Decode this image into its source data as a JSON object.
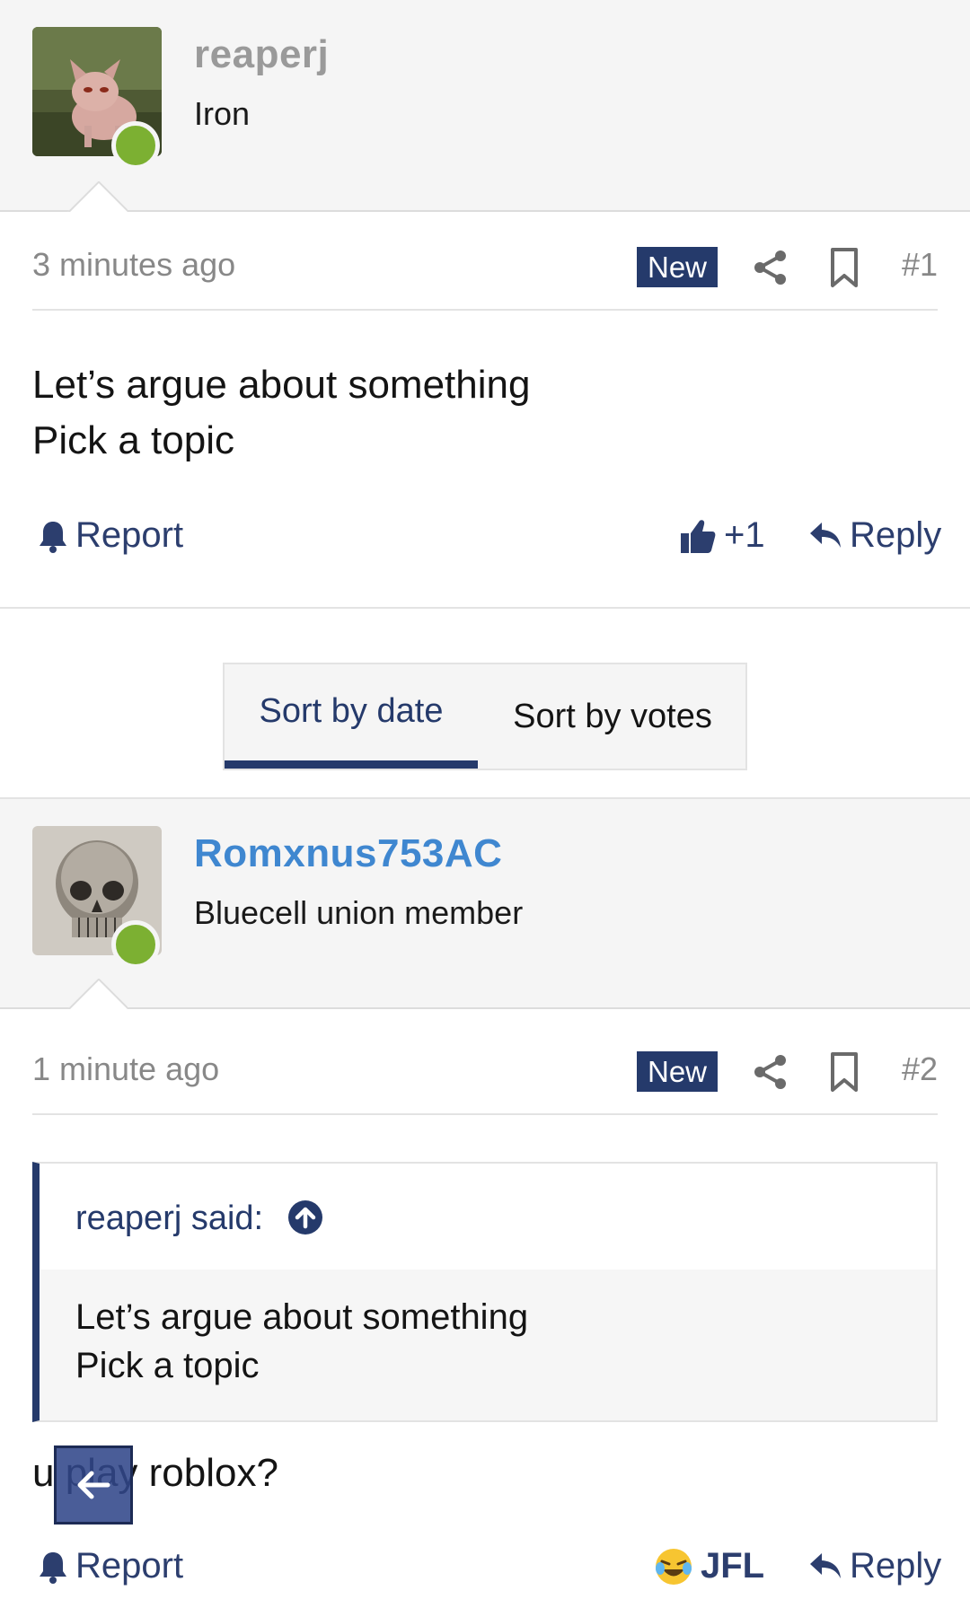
{
  "posts": [
    {
      "username": "reaperj",
      "username_color": "#9a9a9a",
      "user_title": "Iron",
      "time": "3 minutes ago",
      "badge": "New",
      "number": "#1",
      "body_lines": [
        "Let’s argue about something",
        "Pick a topic"
      ],
      "report_label": "Report",
      "reaction_count": "+1",
      "reply_label": "Reply"
    },
    {
      "username": "Romxnus753AC",
      "username_color": "#3f87d0",
      "user_title": "Bluecell union member",
      "time": "1 minute ago",
      "badge": "New",
      "number": "#2",
      "quote": {
        "author": "reaperj said:",
        "lines": [
          "Let’s argue about something",
          "Pick a topic"
        ]
      },
      "body": "u play roblox?",
      "report_label": "Report",
      "reaction_label": "JFL",
      "reply_label": "Reply"
    }
  ],
  "sort": {
    "by_date": "Sort by date",
    "by_votes": "Sort by votes",
    "active": "by_date"
  },
  "colors": {
    "accent": "#253a6b",
    "online": "#7cb032",
    "header_bg": "#f5f5f5"
  },
  "icons": [
    "share-icon",
    "bookmark-icon",
    "bell-icon",
    "thumbs-up-icon",
    "reply-icon",
    "arrow-up-circle-icon",
    "laughing-crying-emoji-icon",
    "arrow-left-icon"
  ]
}
